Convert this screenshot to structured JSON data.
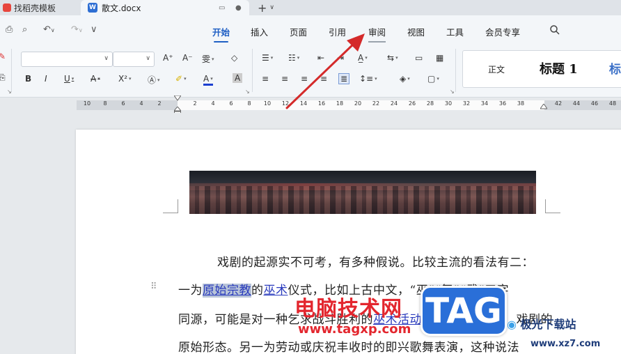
{
  "tabs": [
    {
      "label": "找稻壳模板"
    },
    {
      "label": "散文.docx"
    }
  ],
  "menu": {
    "items": [
      "开始",
      "插入",
      "页面",
      "引用",
      "审阅",
      "视图",
      "工具",
      "会员专享"
    ],
    "active": "开始",
    "highlighted": "审阅"
  },
  "toolbar": {
    "font_name": "",
    "font_size": "",
    "style_normal": "正文",
    "style_h1": "标题 1",
    "style_h2": "标"
  },
  "ruler": {
    "left_numbers": [
      "10",
      "8",
      "6",
      "4",
      "2"
    ],
    "right_numbers": [
      "2",
      "4",
      "6",
      "8",
      "10",
      "12",
      "14",
      "16",
      "18",
      "20",
      "22",
      "24",
      "26",
      "28",
      "30",
      "32",
      "34",
      "36",
      "38"
    ],
    "far_numbers": [
      "42",
      "44",
      "46",
      "48"
    ]
  },
  "document": {
    "line1": "戏剧的起源实不可考，有多种假说。比较主流的看法有二：",
    "line2_a": "一为",
    "line2_sel": "原始宗教",
    "line2_b": "的",
    "line2_link": "巫术",
    "line2_c": "仪式，比如上古中文，“巫”“舞”“武”三字",
    "line3_a": "同源，可能是对一种乞求战斗胜利的",
    "line3_link": "巫术活动",
    "line3_b": "的",
    "line3_c": "戏剧的",
    "line4": "原始形态。另一为劳动或庆祝丰收时的即兴歌舞表演，这种说法"
  },
  "watermarks": {
    "site_name": "电脑技术网",
    "site_url": "www.tagxp.com",
    "tag": "TAG",
    "logo": "极光下载站",
    "logo_url": "www.xz7.com"
  },
  "colors": {
    "accent": "#1f5fc4",
    "arrow": "#d42a2a",
    "link": "#2a3bbd",
    "selection": "#b8c4d8"
  }
}
